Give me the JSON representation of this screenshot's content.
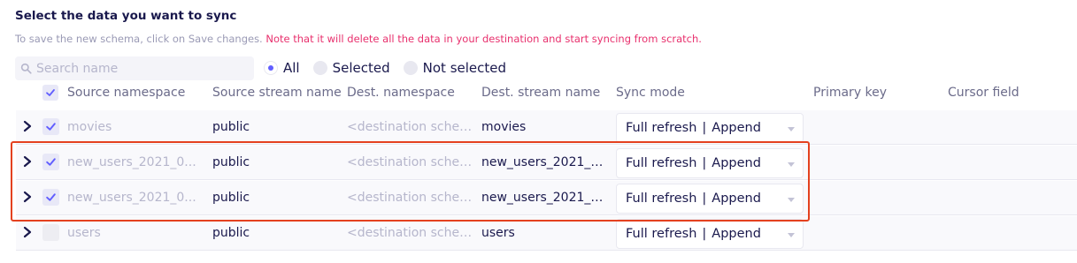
{
  "section": {
    "title": "Select the data you want to sync",
    "note_prefix": "To save the new schema, click on Save changes.",
    "note_warning": "Note that it will delete all the data in your destination and start syncing from scratch."
  },
  "search": {
    "placeholder": "Search name",
    "value": ""
  },
  "filter": {
    "options": [
      "All",
      "Selected",
      "Not selected"
    ],
    "selected": "All"
  },
  "columns": {
    "source_namespace": "Source namespace",
    "source_stream": "Source stream name",
    "dest_namespace": "Dest. namespace",
    "dest_stream": "Dest. stream name",
    "sync_mode": "Sync mode",
    "primary_key": "Primary key",
    "cursor_field": "Cursor field"
  },
  "rows": [
    {
      "checked": true,
      "source_namespace": "movies",
      "source_stream": "public",
      "dest_namespace": "<destination schem...",
      "dest_stream": "movies",
      "sync_left": "Full refresh",
      "sync_right": "Append"
    },
    {
      "checked": true,
      "source_namespace": "new_users_2021_0...",
      "source_stream": "public",
      "dest_namespace": "<destination schem...",
      "dest_stream": "new_users_2021_0...",
      "sync_left": "Full refresh",
      "sync_right": "Append"
    },
    {
      "checked": true,
      "source_namespace": "new_users_2021_0...",
      "source_stream": "public",
      "dest_namespace": "<destination schem...",
      "dest_stream": "new_users_2021_0...",
      "sync_left": "Full refresh",
      "sync_right": "Append"
    },
    {
      "checked": false,
      "source_namespace": "users",
      "source_stream": "public",
      "dest_namespace": "<destination schem...",
      "dest_stream": "users",
      "sync_left": "Full refresh",
      "sync_right": "Append"
    }
  ],
  "colors": {
    "accent": "#615eff",
    "warning_text": "#e8306d",
    "highlight_box": "#e4411f"
  },
  "icons": {
    "search": "search-icon",
    "expand": "chevron-right-icon",
    "check": "check-icon",
    "dropdown": "caret-down-icon"
  }
}
